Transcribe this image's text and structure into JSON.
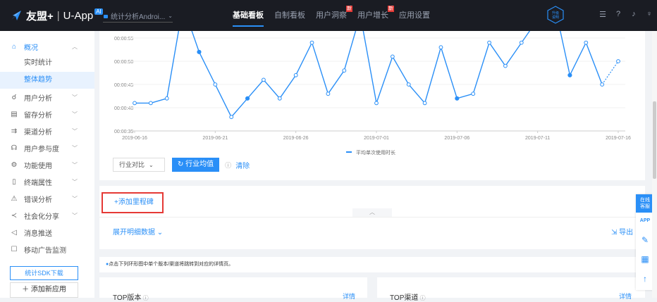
{
  "header": {
    "brand": "友盟+",
    "product": "U-App",
    "ai_badge": "AI",
    "app_selector": "统计分析Androi...",
    "nav": [
      {
        "label": "基础看板",
        "active": true,
        "badge": ""
      },
      {
        "label": "自制看板",
        "active": false,
        "badge": ""
      },
      {
        "label": "用户洞察",
        "active": false,
        "badge": "新"
      },
      {
        "label": "用户增长",
        "active": false,
        "badge": "新"
      },
      {
        "label": "应用设置",
        "active": false,
        "badge": ""
      }
    ],
    "upgrade_badge": "升级\n说明",
    "icons": [
      "list-icon",
      "help-icon",
      "bell-icon",
      "user-icon"
    ]
  },
  "sidebar": {
    "overview": "概况",
    "sub_items": [
      "实时统计",
      "整体趋势"
    ],
    "active_sub": "整体趋势",
    "items": [
      {
        "label": "用户分析",
        "icon": "user-analysis-icon"
      },
      {
        "label": "留存分析",
        "icon": "retention-icon"
      },
      {
        "label": "渠道分析",
        "icon": "channel-icon"
      },
      {
        "label": "用户参与度",
        "icon": "engagement-icon"
      },
      {
        "label": "功能使用",
        "icon": "feature-icon"
      },
      {
        "label": "终端属性",
        "icon": "device-icon"
      },
      {
        "label": "错误分析",
        "icon": "error-icon"
      },
      {
        "label": "社会化分享",
        "icon": "share-icon"
      },
      {
        "label": "消息推送",
        "icon": "push-icon"
      },
      {
        "label": "移动广告监测",
        "icon": "ad-icon"
      }
    ],
    "sdk_button": "统计SDK下载",
    "add_app_button": "添加新应用"
  },
  "chart_data": {
    "type": "line",
    "y_ticks": [
      "00:00:35",
      "00:00:40",
      "00:00:45",
      "00:00:50",
      "00:00:55"
    ],
    "x_ticks": [
      "2019-06-16",
      "2019-06-21",
      "2019-06-26",
      "2019-07-01",
      "2019-07-06",
      "2019-07-11",
      "2019-07-16"
    ],
    "series": [
      {
        "name": "平均单次使用时长",
        "color": "#2a8ff7",
        "values_seconds": [
          41,
          41,
          42,
          62,
          52,
          45,
          38,
          42,
          46,
          42,
          47,
          54,
          43,
          48,
          60,
          41,
          51,
          45,
          41,
          53,
          42,
          43,
          54,
          49,
          54,
          59,
          63,
          47,
          54,
          45,
          50
        ]
      }
    ],
    "dates_start": "2019-06-16",
    "dashed_last_segment": true,
    "ylim_seconds": [
      35,
      55
    ]
  },
  "controls": {
    "compare_select": "行业对比",
    "avg_button": "行业均值",
    "clear_link": "清除"
  },
  "milestone_button": "+添加里程碑",
  "expand_link": "展开明细数据",
  "export_link": "导出",
  "tip": "点击下列环形图中单个版本/渠道将跳转到对应的详情页。",
  "bottom": {
    "top_version": "TOP版本",
    "top_channel": "TOP渠道",
    "detail": "详情"
  },
  "float": {
    "service": "在线\n客服",
    "app": "APP"
  }
}
